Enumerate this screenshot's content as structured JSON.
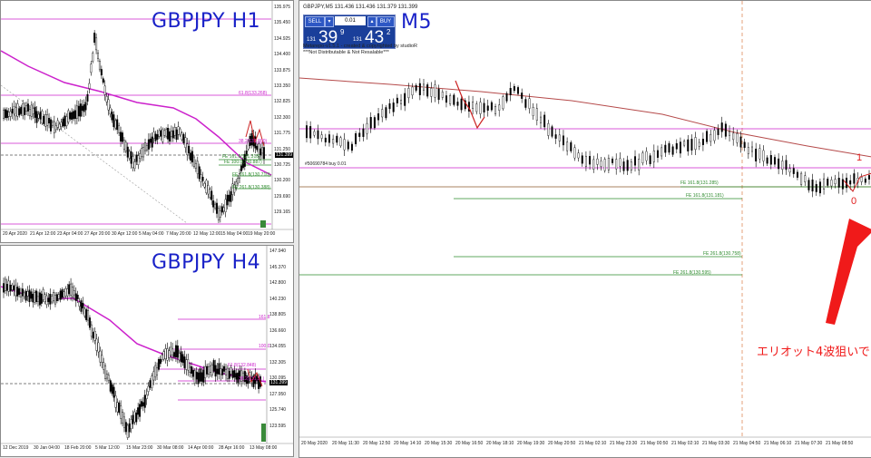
{
  "colors": {
    "candle": "#000000",
    "ma": "#cc22cc",
    "level_magenta": "#cc22cc",
    "level_green": "#2e8b2e",
    "level_red": "#cc2222",
    "title_blue": "#1a22c8",
    "annotation_red": "#f01a1a",
    "trade_panel_blue": "#1a3f9a"
  },
  "h1": {
    "title": "GBPJPY H1",
    "y_ticks": [
      "135.975",
      "135.450",
      "134.925",
      "134.400",
      "133.875",
      "133.350",
      "132.825",
      "132.300",
      "131.775",
      "131.250",
      "130.725",
      "130.200",
      "129.690",
      "129.165"
    ],
    "x_ticks": [
      "20 Apr 2020",
      "21 Apr 12:00",
      "23 Apr 04:00",
      "27 Apr 20:00",
      "30 Apr 12:00",
      "5 May 04:00",
      "7 May 20:00",
      "12 May 12:00",
      "15 May 04:00",
      "19 May 20:00"
    ],
    "price_tag": "131.399",
    "levels": [
      "61.8(133.268)",
      "38.2(131.800)",
      "FE 161.8(131.318)",
      "FE 100.0(130.887)",
      "FE 161.8(130.710)",
      "FE 261.8(130.388)"
    ]
  },
  "h4": {
    "title": "GBPJPY H4",
    "y_ticks": [
      "147.940",
      "145.370",
      "142.800",
      "140.230",
      "138.805",
      "136.660",
      "134.055",
      "132.305",
      "130.095",
      "127.950",
      "125.740",
      "123.595"
    ],
    "x_ticks": [
      "12 Dec 2019",
      "30 Jan 04:00",
      "18 Feb 20:00",
      "5 Mar 12:00",
      "15 Mar 23:00",
      "30 Mar 08:00",
      "14 Apr 00:00",
      "28 Apr 16:00",
      "13 May 08:00"
    ],
    "price_tag": "131.399",
    "levels": [
      "161.8",
      "100.0",
      "61.8(132.848)",
      "38.2(131.3..)"
    ]
  },
  "m5": {
    "header": "GBPJPY,M5  131.436 131.436 131.379 131.399",
    "title_fragment": "M5",
    "trade_panel": {
      "sell": "SELL",
      "buy": "BUY",
      "lot": "0.01",
      "sell_pre": "131",
      "sell_main": "39",
      "sell_sup": "9",
      "buy_pre": "131",
      "buy_main": "43",
      "buy_sup": "2"
    },
    "credit_line1": "Metarepo-v1.5.1 - created & copyrighted by studioR",
    "credit_line2": "***Not Distributable & Not Resalable***",
    "order_label": "#50690784 buy 0.01",
    "fe_levels": [
      "FE 161.8(131.285)",
      "FE 161.8(131.181)",
      "FE 261.8(130.758)",
      "FE 261.8(130.595)"
    ],
    "x_ticks": [
      "20 May 2020",
      "20 May 11:30",
      "20 May 12:50",
      "20 May 14:10",
      "20 May 15:30",
      "20 May 16:50",
      "20 May 18:10",
      "20 May 19:30",
      "20 May 20:50",
      "21 May 02:10",
      "21 May 23:30",
      "21 May 00:50",
      "21 May 02:10",
      "21 May 03:30",
      "21 May 04:50",
      "21 May 06:10",
      "21 May 07:30",
      "21 May 08:50"
    ],
    "wave_labels": [
      "1",
      "0"
    ],
    "annotation": "エリオット4波狙いで"
  }
}
